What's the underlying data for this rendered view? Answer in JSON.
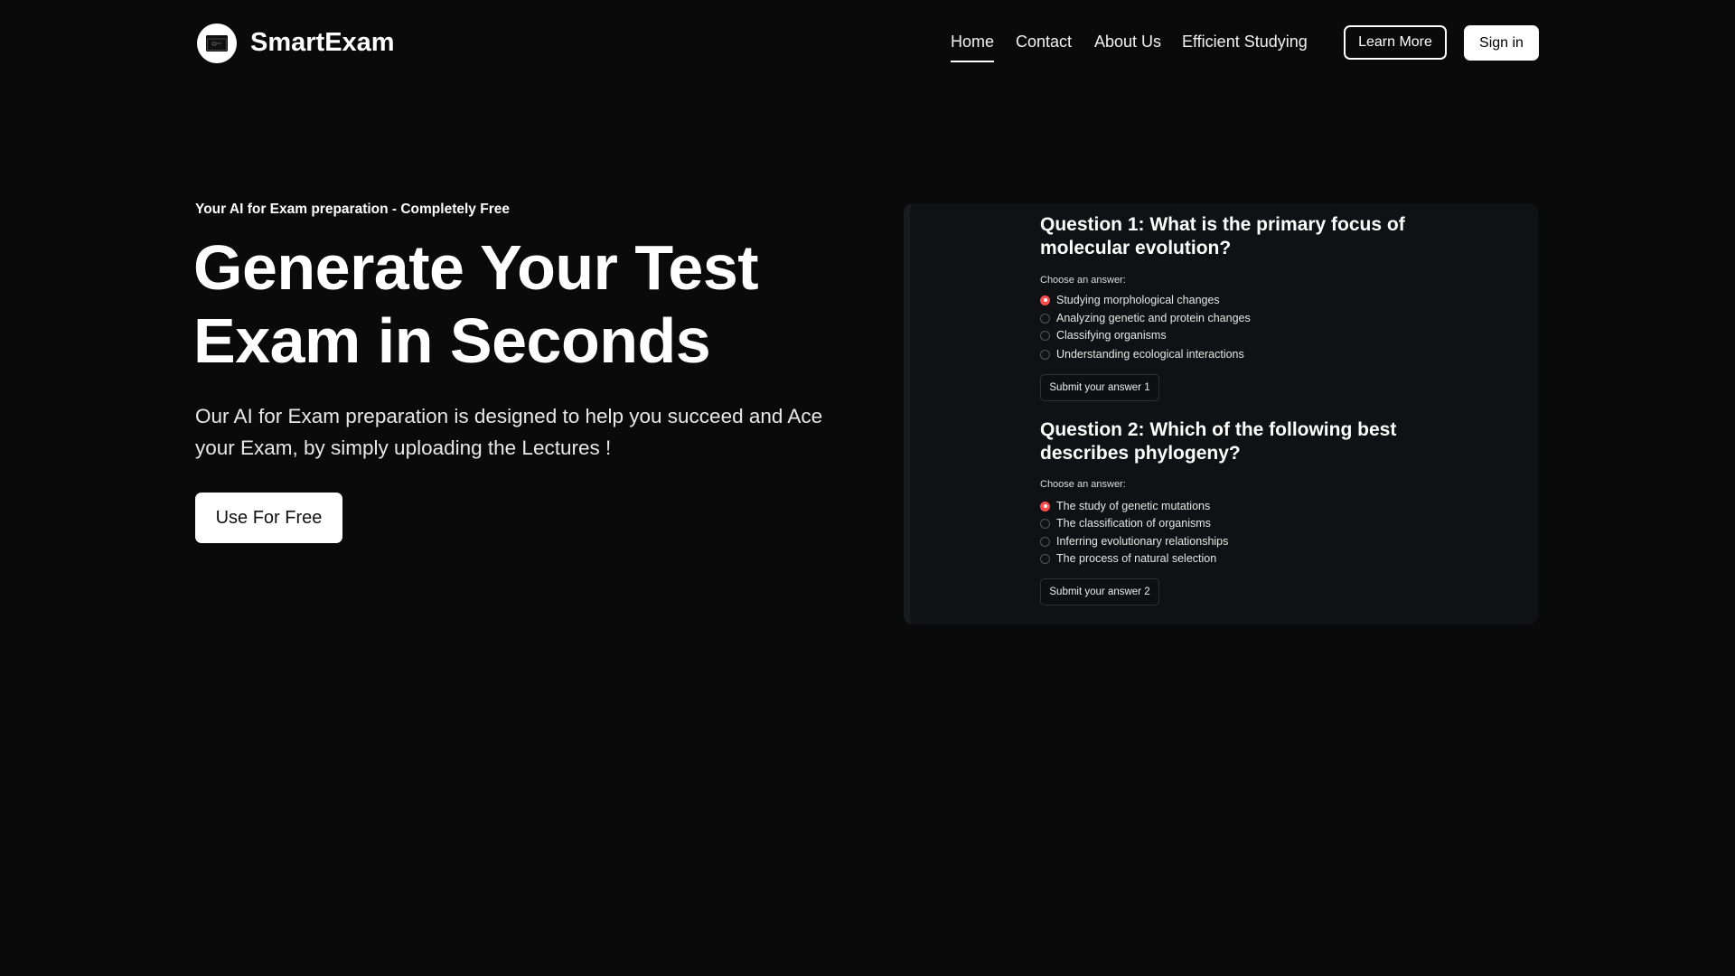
{
  "header": {
    "brand": "SmartExam",
    "nav": [
      {
        "label": "Home",
        "active": true
      },
      {
        "label": "Contact"
      },
      {
        "label": "About Us"
      },
      {
        "label": "Efficient Studying"
      }
    ],
    "learn_more": "Learn More",
    "sign_in": "Sign in"
  },
  "hero": {
    "tagline": "Your AI for Exam preparation - Completely Free",
    "headline_line1": "Generate Your Test",
    "headline_line2": "Exam in Seconds",
    "description": "Our AI for Exam preparation is designed to help you succeed and Ace your Exam, by simply uploading the Lectures !",
    "cta": "Use For Free"
  },
  "quiz": {
    "accent_color": "#ff4b4b",
    "questions": [
      {
        "title": "Question 1: What is the primary focus of molecular evolution?",
        "prompt": "Choose an answer:",
        "options": [
          "Studying morphological changes",
          "Analyzing genetic and protein changes",
          "Classifying organisms",
          "Understanding ecological interactions"
        ],
        "selected_index": 0,
        "submit": "Submit your answer 1"
      },
      {
        "title": "Question 2: Which of the following best describes phylogeny?",
        "prompt": "Choose an answer:",
        "options": [
          "The study of genetic mutations",
          "The classification of organisms",
          "Inferring evolutionary relationships",
          "The process of natural selection"
        ],
        "selected_index": 0,
        "submit": "Submit your answer 2"
      }
    ]
  }
}
